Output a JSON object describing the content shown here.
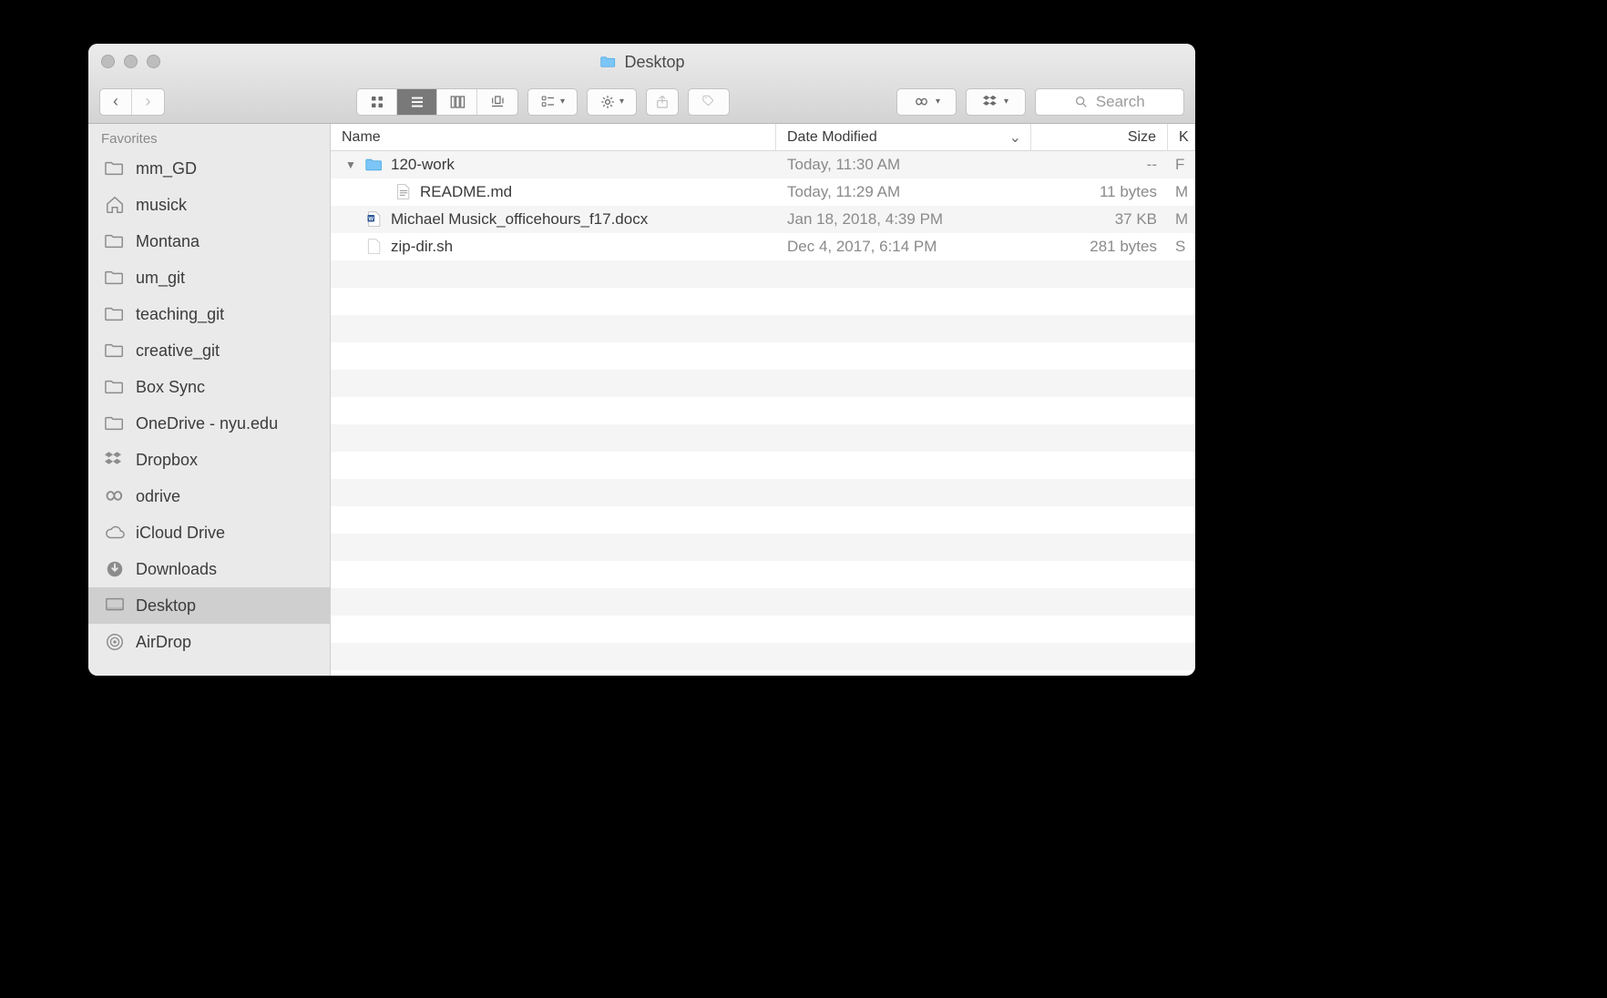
{
  "window": {
    "title": "Desktop"
  },
  "toolbar": {
    "search_placeholder": "Search"
  },
  "sidebar": {
    "header": "Favorites",
    "items": [
      {
        "icon": "folder",
        "label": "mm_GD"
      },
      {
        "icon": "home",
        "label": "musick"
      },
      {
        "icon": "folder",
        "label": "Montana"
      },
      {
        "icon": "folder",
        "label": "um_git"
      },
      {
        "icon": "folder",
        "label": "teaching_git"
      },
      {
        "icon": "folder",
        "label": "creative_git"
      },
      {
        "icon": "folder",
        "label": "Box Sync"
      },
      {
        "icon": "folder",
        "label": "OneDrive - nyu.edu"
      },
      {
        "icon": "dropbox",
        "label": "Dropbox"
      },
      {
        "icon": "infinity",
        "label": "odrive"
      },
      {
        "icon": "cloud",
        "label": "iCloud Drive"
      },
      {
        "icon": "download",
        "label": "Downloads"
      },
      {
        "icon": "desktop",
        "label": "Desktop",
        "selected": true
      },
      {
        "icon": "airdrop",
        "label": "AirDrop"
      }
    ]
  },
  "columns": {
    "name": "Name",
    "date": "Date Modified",
    "size": "Size",
    "kind": "K"
  },
  "files": [
    {
      "indent": 1,
      "expanded": true,
      "icon": "folder-blue",
      "name": "120-work",
      "date": "Today, 11:30 AM",
      "size": "--",
      "kind": "F",
      "muted": true
    },
    {
      "indent": 2,
      "icon": "doc",
      "name": "README.md",
      "date": "Today, 11:29 AM",
      "size": "11 bytes",
      "kind": "M",
      "muted": true
    },
    {
      "indent": 1,
      "icon": "docx",
      "name": "Michael Musick_officehours_f17.docx",
      "date": "Jan 18, 2018, 4:39 PM",
      "size": "37 KB",
      "kind": "M",
      "muted": true
    },
    {
      "indent": 1,
      "icon": "blank",
      "name": "zip-dir.sh",
      "date": "Dec 4, 2017, 6:14 PM",
      "size": "281 bytes",
      "kind": "S",
      "muted": true
    }
  ]
}
